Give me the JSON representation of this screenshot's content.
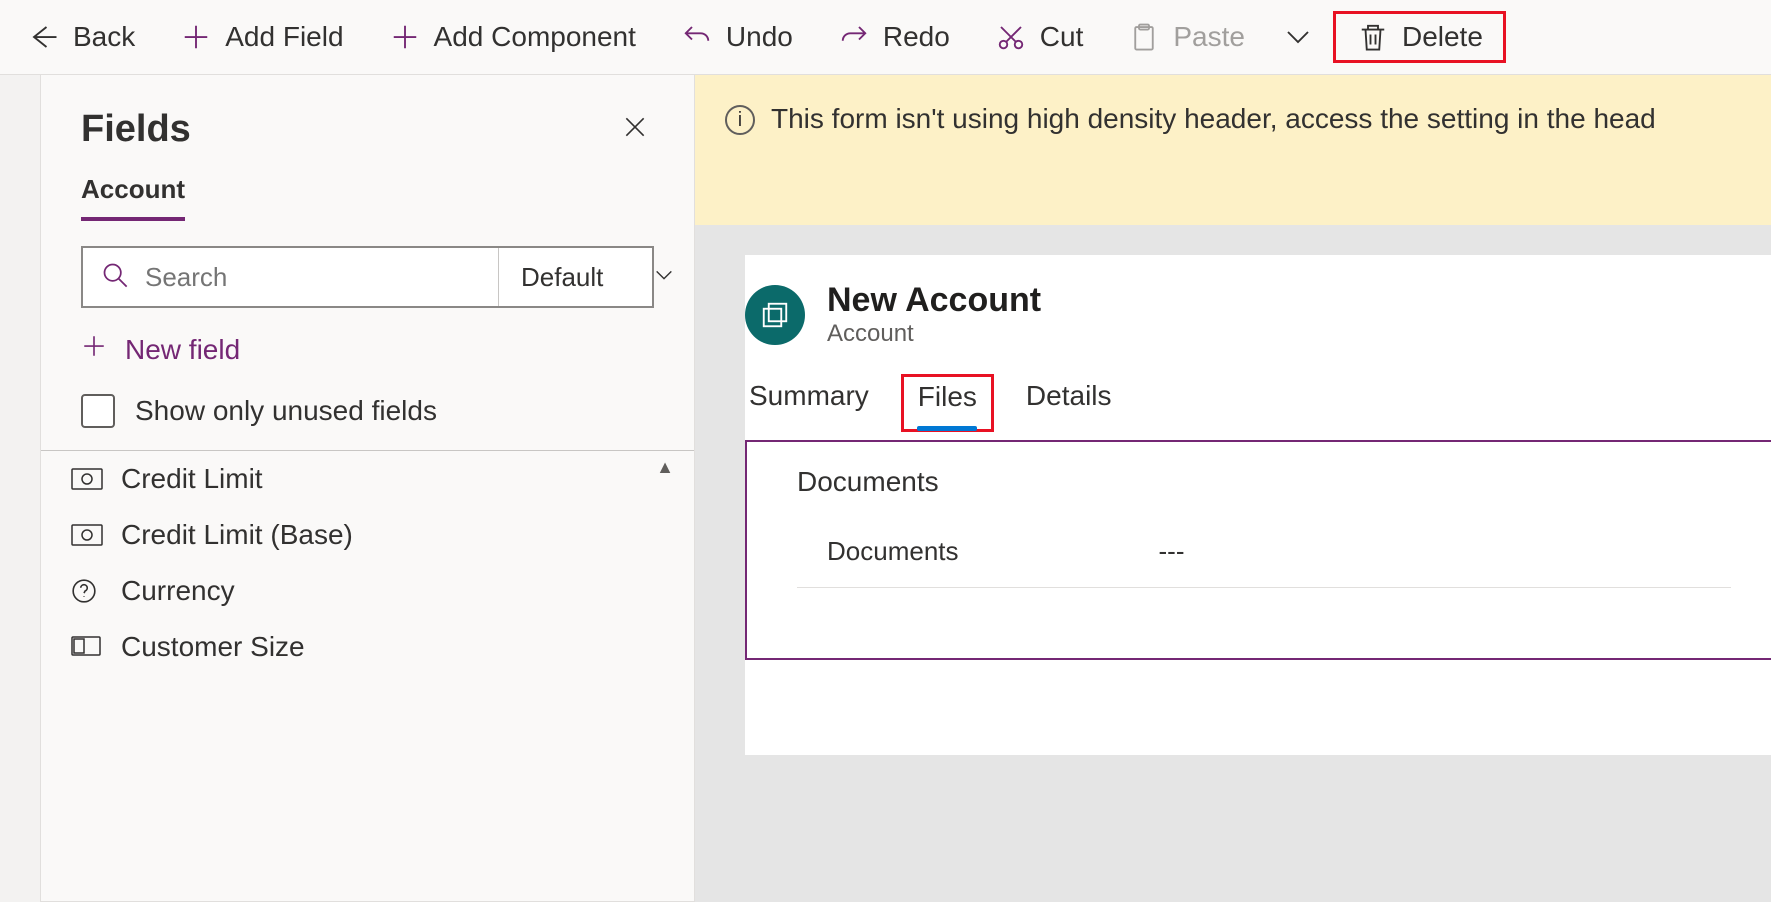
{
  "toolbar": {
    "back": "Back",
    "add_field": "Add Field",
    "add_component": "Add Component",
    "undo": "Undo",
    "redo": "Redo",
    "cut": "Cut",
    "paste": "Paste",
    "delete": "Delete"
  },
  "panel": {
    "title": "Fields",
    "active_tab": "Account",
    "search_placeholder": "Search",
    "dropdown_value": "Default",
    "new_field": "New field",
    "unused_only": "Show only unused fields",
    "fields": [
      {
        "label": "Credit Limit",
        "icon": "currency-icon"
      },
      {
        "label": "Credit Limit (Base)",
        "icon": "currency-icon"
      },
      {
        "label": "Currency",
        "icon": "help-icon"
      },
      {
        "label": "Customer Size",
        "icon": "option-icon"
      }
    ]
  },
  "notice": {
    "text": "This form isn't using high density header, access the setting in the head"
  },
  "form": {
    "title": "New Account",
    "subtitle": "Account",
    "tabs": [
      {
        "label": "Summary",
        "active": false
      },
      {
        "label": "Files",
        "active": true
      },
      {
        "label": "Details",
        "active": false
      }
    ],
    "region_title": "Documents",
    "row_label": "Documents",
    "row_value": "---"
  }
}
